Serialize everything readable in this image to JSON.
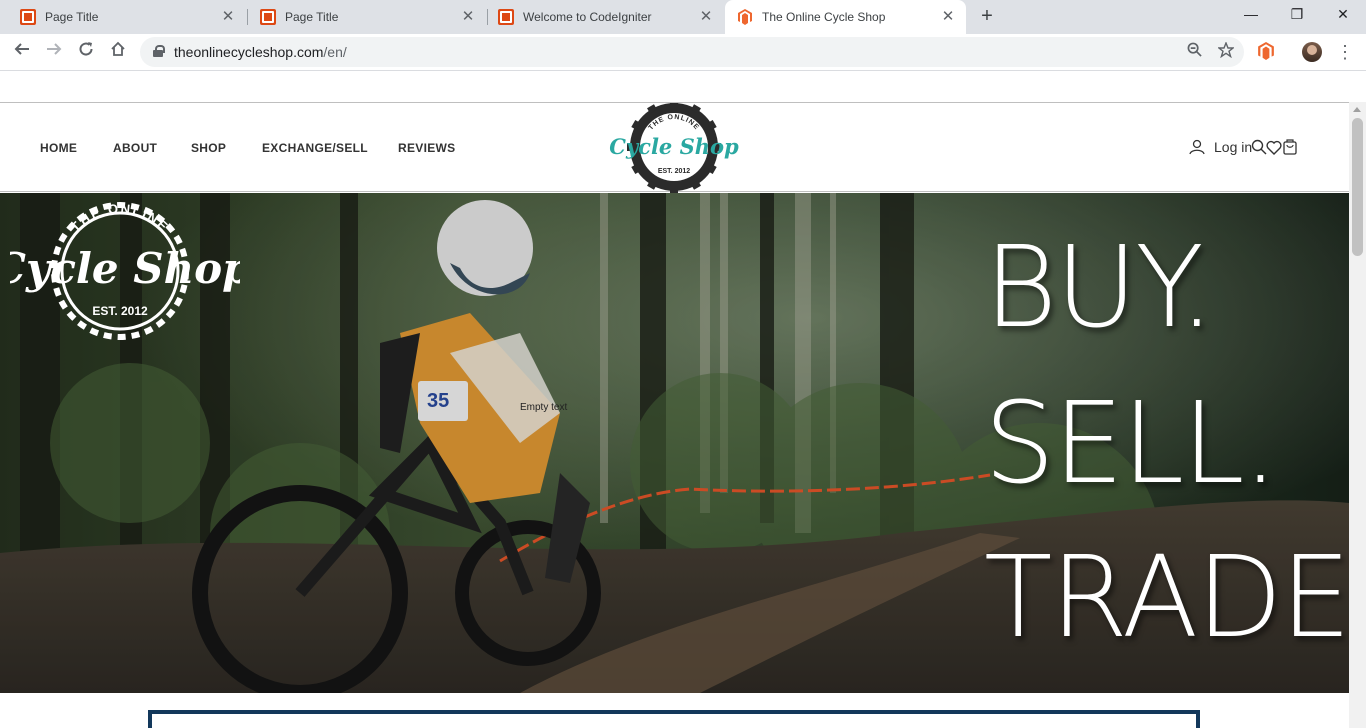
{
  "browser": {
    "tabs": [
      {
        "title": "Page Title",
        "favicon": "codeigniter-icon",
        "active": false
      },
      {
        "title": "Page Title",
        "favicon": "codeigniter-icon",
        "active": false
      },
      {
        "title": "Welcome to CodeIgniter",
        "favicon": "codeigniter-icon",
        "active": false
      },
      {
        "title": "The Online Cycle Shop",
        "favicon": "magento-icon",
        "active": true
      }
    ],
    "close_glyph": "✕",
    "new_tab_glyph": "+",
    "window_controls": {
      "minimize": "—",
      "restore": "❐",
      "close": "✕"
    },
    "url_host": "theonlinecycleshop.com",
    "url_path": "/en/"
  },
  "site": {
    "nav": [
      "HOME",
      "ABOUT",
      "SHOP",
      "EXCHANGE/SELL",
      "REVIEWS"
    ],
    "login_label": "Log in",
    "logo": {
      "top_text": "THE ONLINE",
      "script_text": "Cycle Shop",
      "bottom_text": "EST. 2012"
    },
    "hero": {
      "lines": [
        "BUY.",
        "SELL.",
        "TRADE."
      ],
      "empty_text": "Empty text"
    },
    "colors": {
      "brand_teal": "#2aa8a1",
      "dark_ring": "#2b2b2b",
      "box_border": "#13385b"
    }
  }
}
